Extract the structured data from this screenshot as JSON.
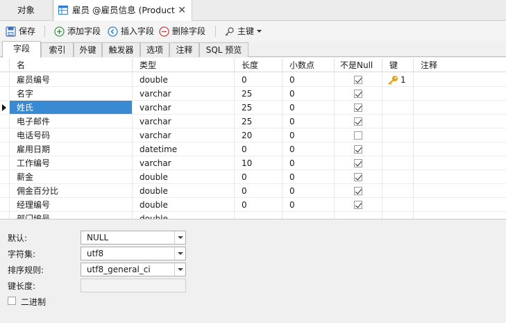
{
  "tabs": {
    "objects": "对象",
    "active": "雇员 @雇员信息 (Product...",
    "close": "✕"
  },
  "toolbar": {
    "save": "保存",
    "add_field": "添加字段",
    "insert_field": "插入字段",
    "delete_field": "删除字段",
    "primary_key": "主键"
  },
  "subtabs": [
    "字段",
    "索引",
    "外键",
    "触发器",
    "选项",
    "注释",
    "SQL 预览"
  ],
  "columns": [
    "名",
    "类型",
    "长度",
    "小数点",
    "不是Null",
    "键",
    "注释"
  ],
  "rows": [
    {
      "name": "雇员编号",
      "type": "double",
      "length": "0",
      "decimals": "0",
      "not_null": true,
      "key": "1"
    },
    {
      "name": "名字",
      "type": "varchar",
      "length": "25",
      "decimals": "0",
      "not_null": true,
      "key": ""
    },
    {
      "name": "姓氏",
      "type": "varchar",
      "length": "25",
      "decimals": "0",
      "not_null": true,
      "key": ""
    },
    {
      "name": "电子邮件",
      "type": "varchar",
      "length": "25",
      "decimals": "0",
      "not_null": true,
      "key": ""
    },
    {
      "name": "电话号码",
      "type": "varchar",
      "length": "20",
      "decimals": "0",
      "not_null": false,
      "key": ""
    },
    {
      "name": "雇用日期",
      "type": "datetime",
      "length": "0",
      "decimals": "0",
      "not_null": true,
      "key": ""
    },
    {
      "name": "工作编号",
      "type": "varchar",
      "length": "10",
      "decimals": "0",
      "not_null": true,
      "key": ""
    },
    {
      "name": "薪金",
      "type": "double",
      "length": "0",
      "decimals": "0",
      "not_null": true,
      "key": ""
    },
    {
      "name": "佣金百分比",
      "type": "double",
      "length": "0",
      "decimals": "0",
      "not_null": true,
      "key": ""
    },
    {
      "name": "经理编号",
      "type": "double",
      "length": "0",
      "decimals": "0",
      "not_null": true,
      "key": ""
    },
    {
      "name": "部门编号",
      "type": "double",
      "length": "",
      "decimals": "",
      "not_null": false,
      "key": ""
    }
  ],
  "selected_row": 2,
  "props": {
    "default_label": "默认:",
    "default_value": "NULL",
    "charset_label": "字符集:",
    "charset_value": "utf8",
    "collation_label": "排序规则:",
    "collation_value": "utf8_general_ci",
    "key_length_label": "键长度:",
    "binary_label": "二进制"
  },
  "colors": {
    "selection": "#3a8ad3",
    "key": "#e3a21a"
  }
}
